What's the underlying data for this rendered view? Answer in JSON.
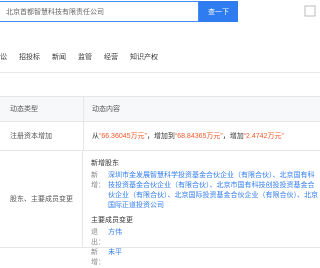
{
  "search": {
    "value": "北京首都智慧科技有限责任公司",
    "button_label": "查一下"
  },
  "tabs": [
    "讼",
    "招投标",
    "新闻",
    "监管",
    "经营",
    "知识产权"
  ],
  "table": {
    "headers": {
      "type": "动态类型",
      "content": "动态内容"
    },
    "reg_capital": {
      "type": "注册资本增加",
      "from_prefix": "从 ",
      "from_value": "“66.36045万元”",
      "add_prefix": "，增加到 ",
      "to_value": "“68.84365万元”",
      "inc_prefix": "，增加 ",
      "inc_value": "“2.4742万元”"
    },
    "shareholders": {
      "type": "股东、主要成员变更",
      "new_share_title": "新增股东",
      "new_prefix": "新增：",
      "new_holders": "深圳市金发展智慧科学投资基金合伙企业（有限合伙）、北京国有科技投资基金合伙企业（有限合伙）、北京市国有科技创投投资基金合伙企业（有限合伙）、北京国际投资基金合伙企业（有限合伙）、北京国际正道投资公司",
      "members_title": "主要成员变更",
      "exit_label": "退出：",
      "exit_name": "方伟",
      "new_label": "新增：",
      "new_name": "未平"
    }
  }
}
